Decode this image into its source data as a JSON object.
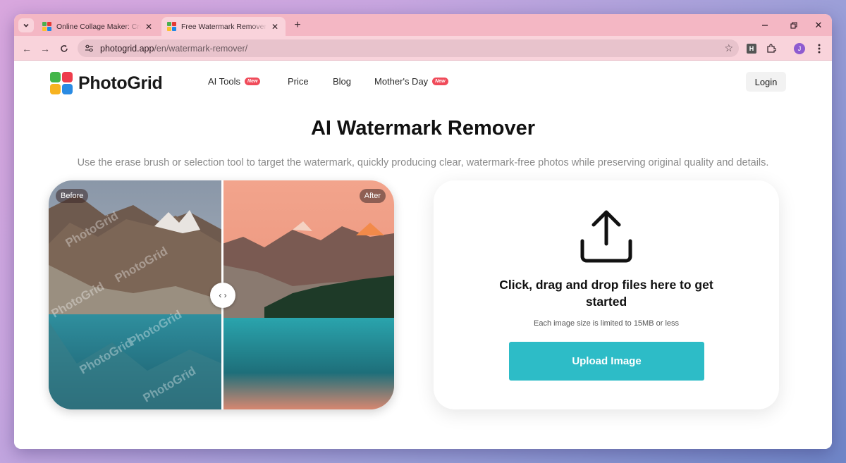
{
  "browser": {
    "tabs": [
      {
        "title": "Online Collage Maker: Create Free Photo Collages",
        "active": false
      },
      {
        "title": "Free Watermark Remover - Remove Watermarks from Photos",
        "active": true
      }
    ],
    "url": {
      "domain": "photogrid.app",
      "path": "/en/watermark-remover/"
    },
    "profile_initial": "J",
    "extension_label": "H"
  },
  "site": {
    "logo_text": "PhotoGrid",
    "nav": [
      {
        "label": "AI Tools",
        "badge": "New"
      },
      {
        "label": "Price"
      },
      {
        "label": "Blog"
      },
      {
        "label": "Mother's Day",
        "badge": "New"
      }
    ],
    "login_label": "Login"
  },
  "hero": {
    "title": "AI Watermark Remover",
    "subtitle": "Use the erase brush or selection tool to target the watermark, quickly producing clear, watermark-free photos while preserving original quality and details."
  },
  "compare": {
    "before_label": "Before",
    "after_label": "After",
    "watermark_text": "PhotoGrid",
    "handle_glyph": "‹ ›"
  },
  "upload": {
    "headline": "Click, drag and drop files here to get started",
    "limit": "Each image size is limited to 15MB or less",
    "button_label": "Upload Image",
    "accent_color": "#2dbcc7"
  }
}
